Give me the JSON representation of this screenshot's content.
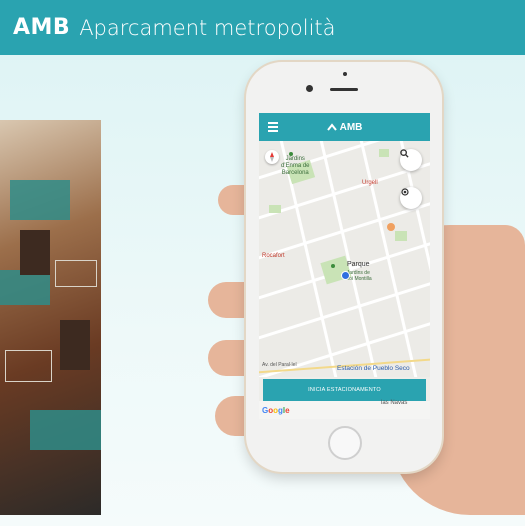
{
  "header": {
    "brand": "AMB",
    "subtitle": "Aparcament metropolità"
  },
  "app": {
    "title": "AMB",
    "start_button": "INICIA ESTACIONAMENTO",
    "map_labels": {
      "jardins": "Jardins\nd'Enma de\nBarcelona",
      "urgell": "Urgell",
      "rocafort": "Rocafort",
      "parque": "Parque",
      "parque_sub": "Jardins de\nMoi Montilla",
      "estacion": "Estación de Pueblo Seco",
      "av_parallel": "Av. del Paral·lel",
      "las_navas": "las Navas"
    },
    "google": [
      "G",
      "o",
      "o",
      "g",
      "l",
      "e"
    ]
  },
  "colors": {
    "accent": "#2aa3b0",
    "background": "#e6f6f6"
  }
}
